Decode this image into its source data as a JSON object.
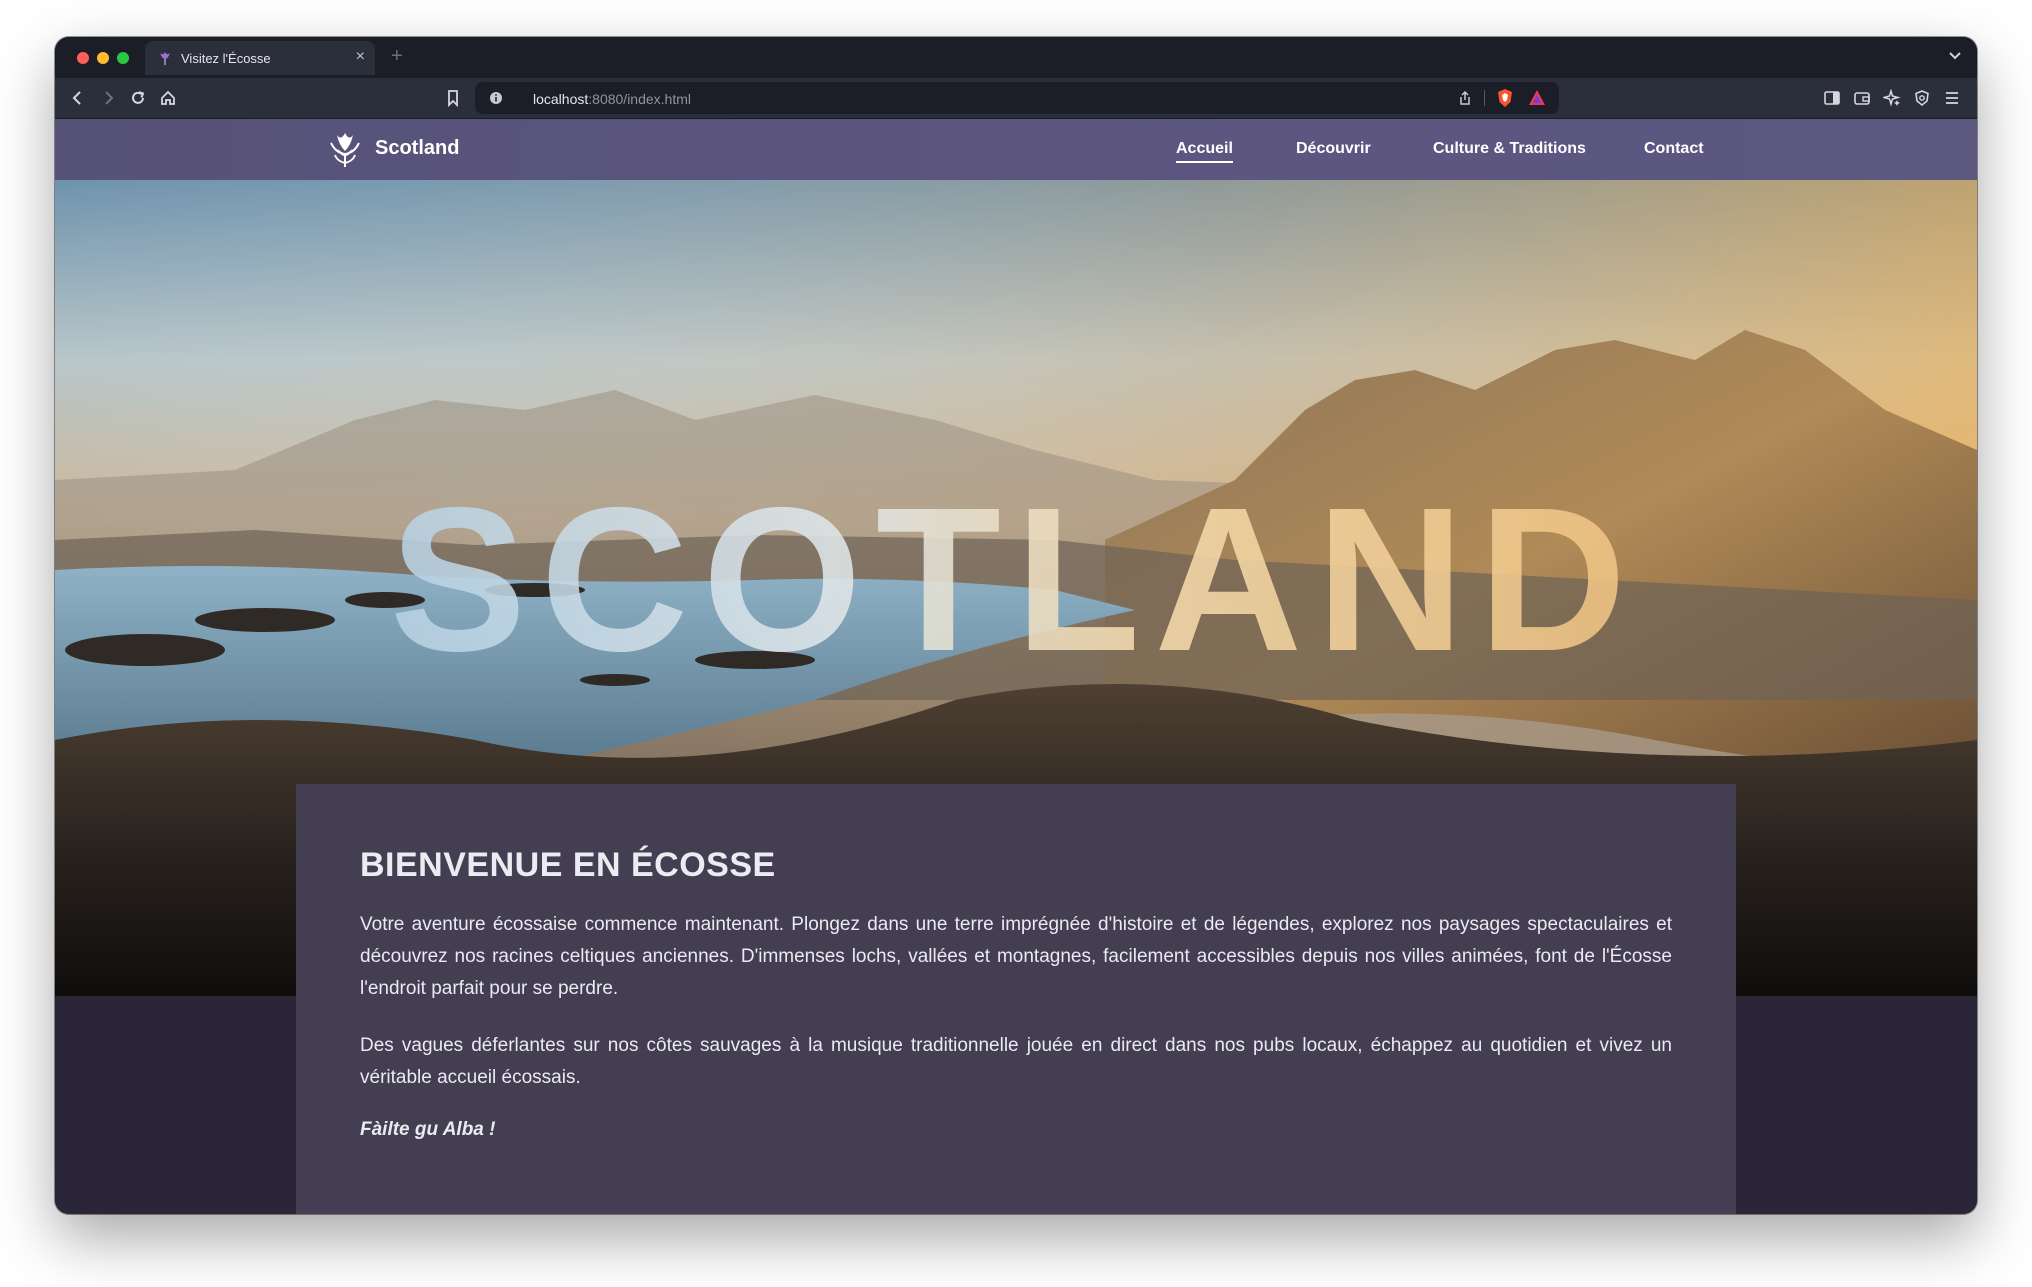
{
  "browser": {
    "tab_title": "Visitez l'Écosse",
    "tab_close": "×",
    "new_tab": "+",
    "url_host": "localhost",
    "url_path": ":8080/index.html",
    "icons": [
      "back-icon",
      "forward-icon",
      "reload-icon",
      "home-icon",
      "bookmark-icon",
      "site-info-icon",
      "share-icon",
      "brave-shield-icon",
      "brave-rewards-icon",
      "sidebar-icon",
      "wallet-icon",
      "leo-ai-icon",
      "vpn-icon",
      "menu-icon",
      "tab-list-icon"
    ]
  },
  "navbar": {
    "brand": "Scotland",
    "links": [
      "Accueil",
      "Découvrir",
      "Culture & Traditions",
      "Contact"
    ],
    "active_link": "Accueil",
    "background_color": "#5a5480"
  },
  "hero": {
    "overlay_text": "SCOTLAND"
  },
  "content": {
    "title": "BIENVENUE EN ÉCOSSE",
    "paragraphs": [
      "Votre aventure écossaise commence maintenant. Plongez dans une terre imprégnée d'histoire et de légendes, explorez nos paysages spectaculaires et découvrez nos racines celtiques anciennes. D'immenses lochs, vallées et montagnes, facilement accessibles depuis nos villes animées, font de l'Écosse l'endroit parfait pour se perdre.",
      "Des vagues déferlantes sur nos côtes sauvages à la musique traditionnelle jouée en direct dans nos pubs locaux, échappez au quotidien et vivez un véritable accueil écossais."
    ],
    "greeting": "Fàilte gu Alba !",
    "card_color": "#433e51",
    "page_color": "#2a2638"
  }
}
